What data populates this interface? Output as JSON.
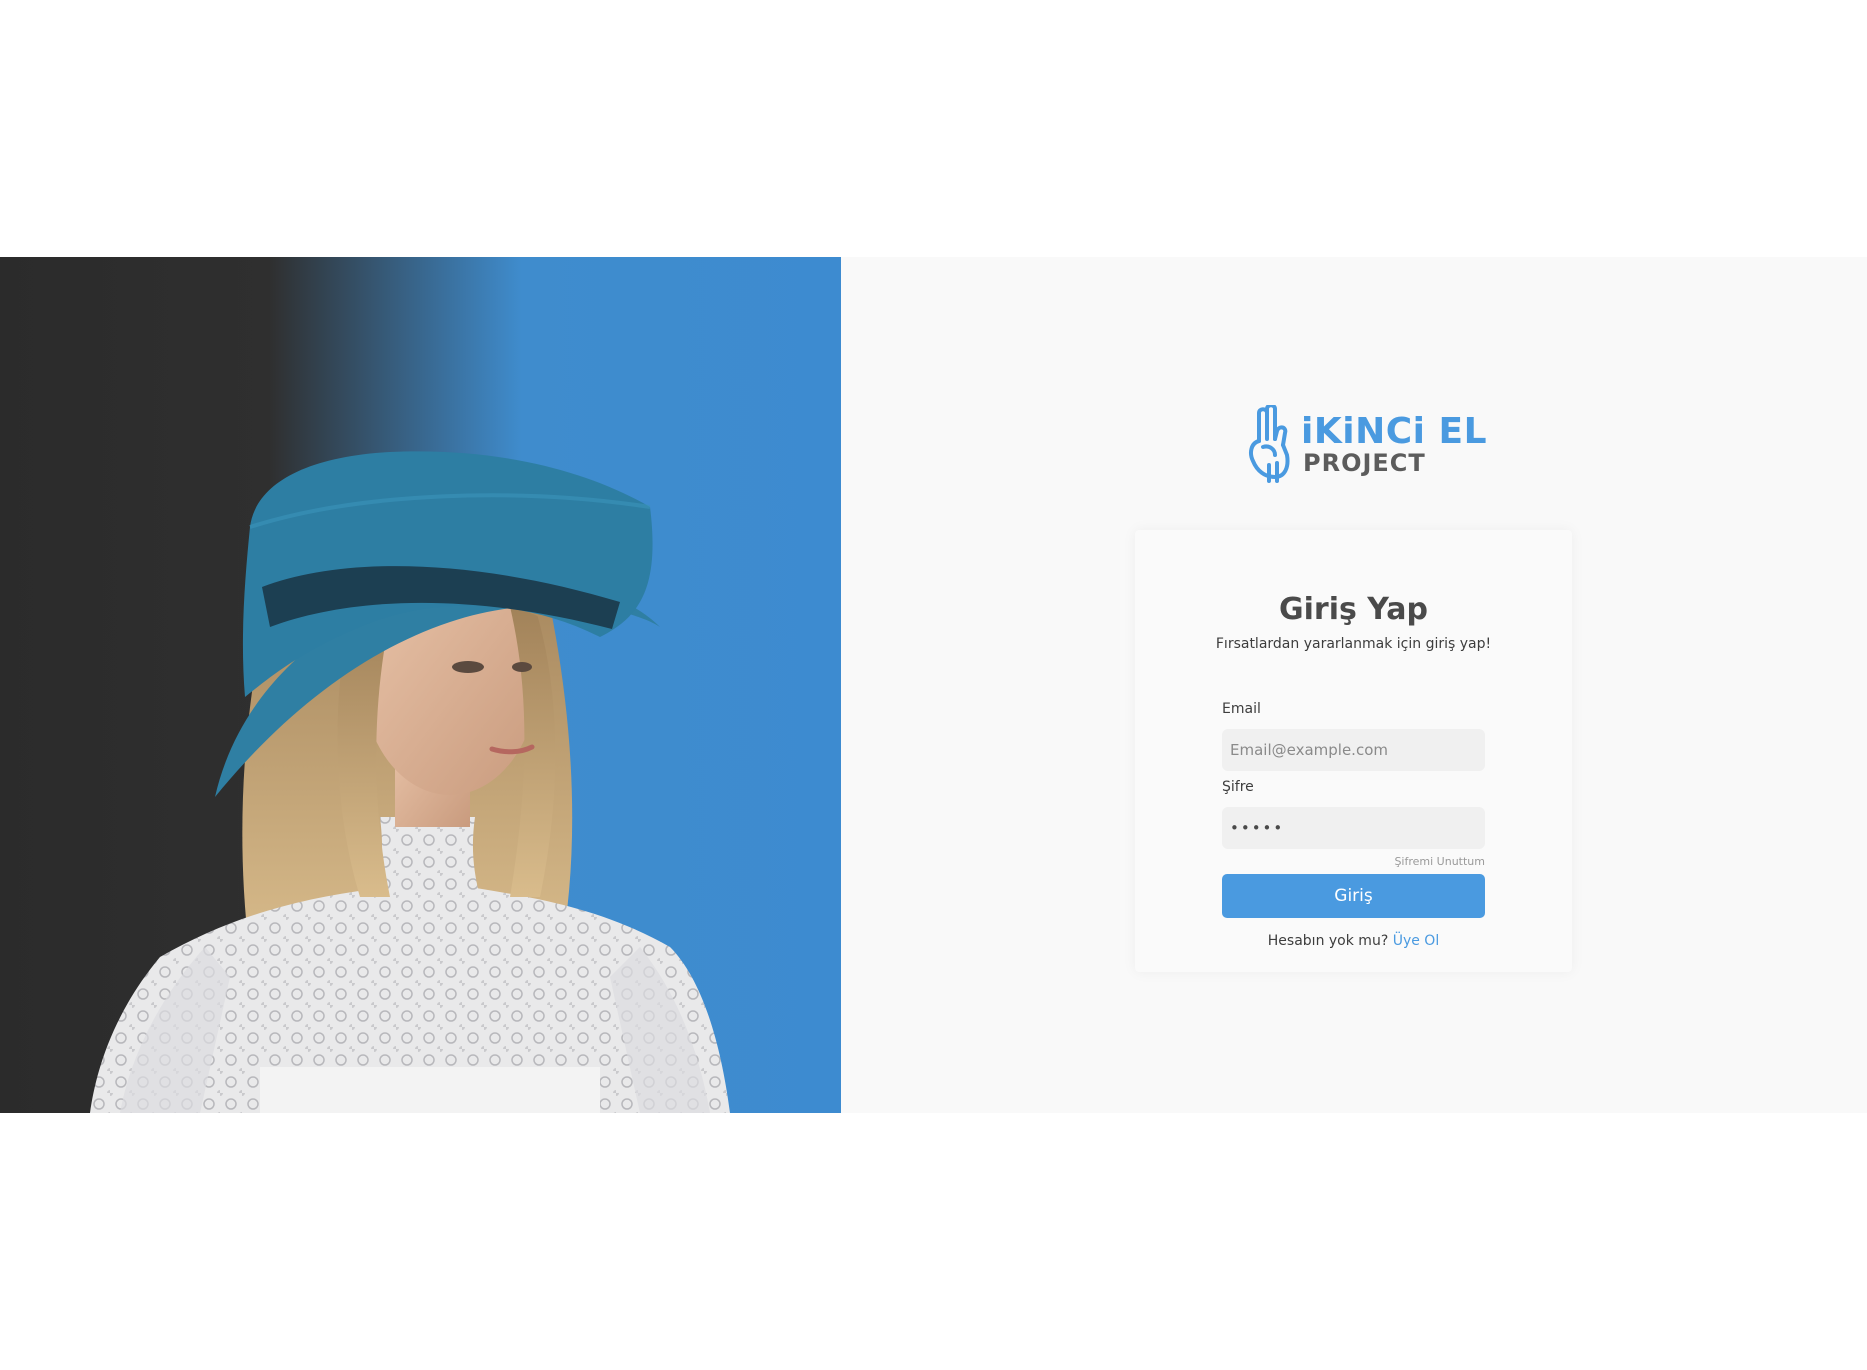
{
  "brand": {
    "name_line1": "iKiNCi EL",
    "name_line2": "PROJECT",
    "logo_icon": "peace-hand-icon",
    "accent_color": "#4a9ae0"
  },
  "hero": {
    "image": "woman-in-blue-hat-photo"
  },
  "login": {
    "title": "Giriş Yap",
    "subtitle": "Fırsatlardan yararlanmak için giriş yap!",
    "email_label": "Email",
    "email_placeholder": "Email@example.com",
    "email_value": "",
    "password_label": "Şifre",
    "password_value": "•••••",
    "forgot_label": "Şifremi Unuttum",
    "submit_label": "Giriş",
    "register_prompt": "Hesabın yok mu?",
    "register_link": "Üye Ol"
  }
}
